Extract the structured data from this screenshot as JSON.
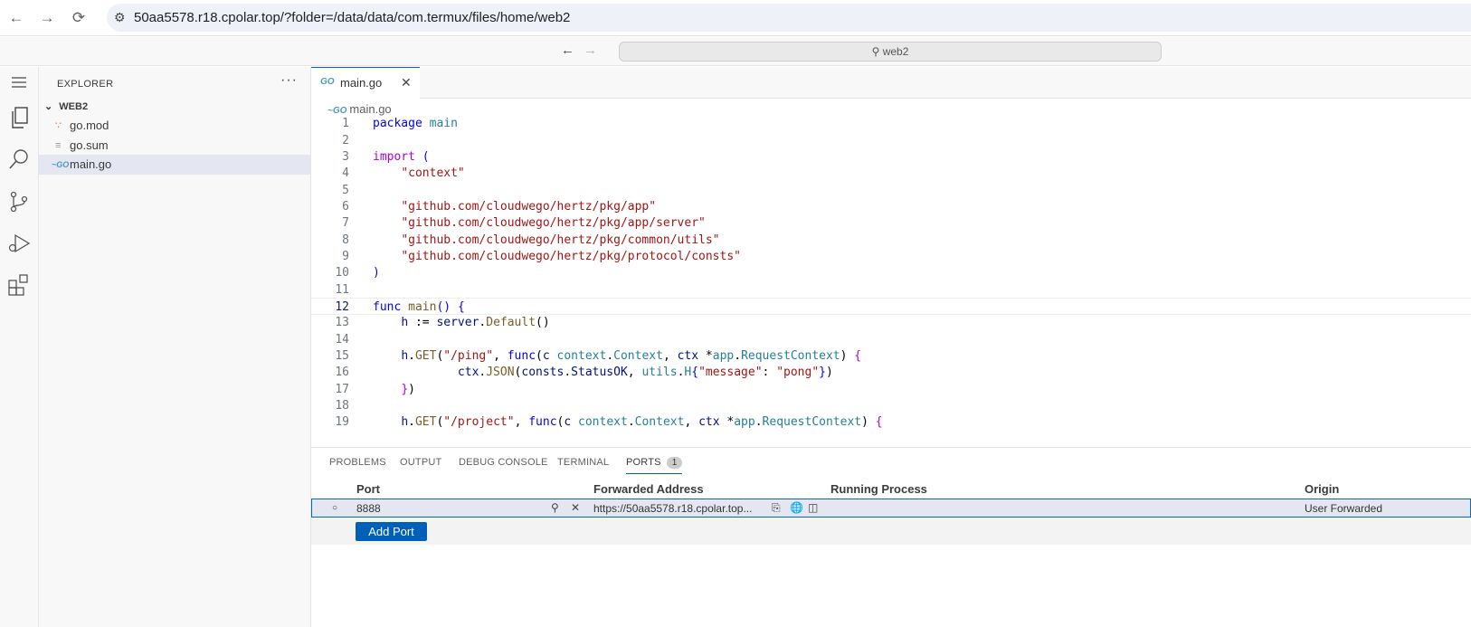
{
  "browser": {
    "url": "50aa5578.r18.cpolar.top/?folder=/data/data/com.termux/files/home/web2"
  },
  "titlebar": {
    "search_label": "web2"
  },
  "sidebar": {
    "title": "EXPLORER",
    "more": "···",
    "folder": "WEB2",
    "files": [
      {
        "name": "go.mod",
        "icon": "rss-icon"
      },
      {
        "name": "go.sum",
        "icon": "lines-icon"
      },
      {
        "name": "main.go",
        "icon": "go-icon",
        "selected": true
      }
    ]
  },
  "editor": {
    "tab_label": "main.go",
    "tab_icon": "GO",
    "breadcrumb": "main.go",
    "lines": [
      "1",
      "2",
      "3",
      "4",
      "5",
      "6",
      "7",
      "8",
      "9",
      "10",
      "11",
      "12",
      "13",
      "14",
      "15",
      "16",
      "17",
      "18",
      "19"
    ]
  },
  "panel": {
    "tabs": [
      "PROBLEMS",
      "OUTPUT",
      "DEBUG CONSOLE",
      "TERMINAL",
      "PORTS"
    ],
    "ports_badge": "1",
    "headers": {
      "port": "Port",
      "address": "Forwarded Address",
      "process": "Running Process",
      "origin": "Origin"
    },
    "row": {
      "port": "8888",
      "address": "https://50aa5578.r18.cpolar.top...",
      "process": "",
      "origin": "User Forwarded"
    },
    "add_port": "Add Port"
  },
  "colors": {
    "accent": "#005fb8",
    "selection": "#e4e6f1"
  }
}
